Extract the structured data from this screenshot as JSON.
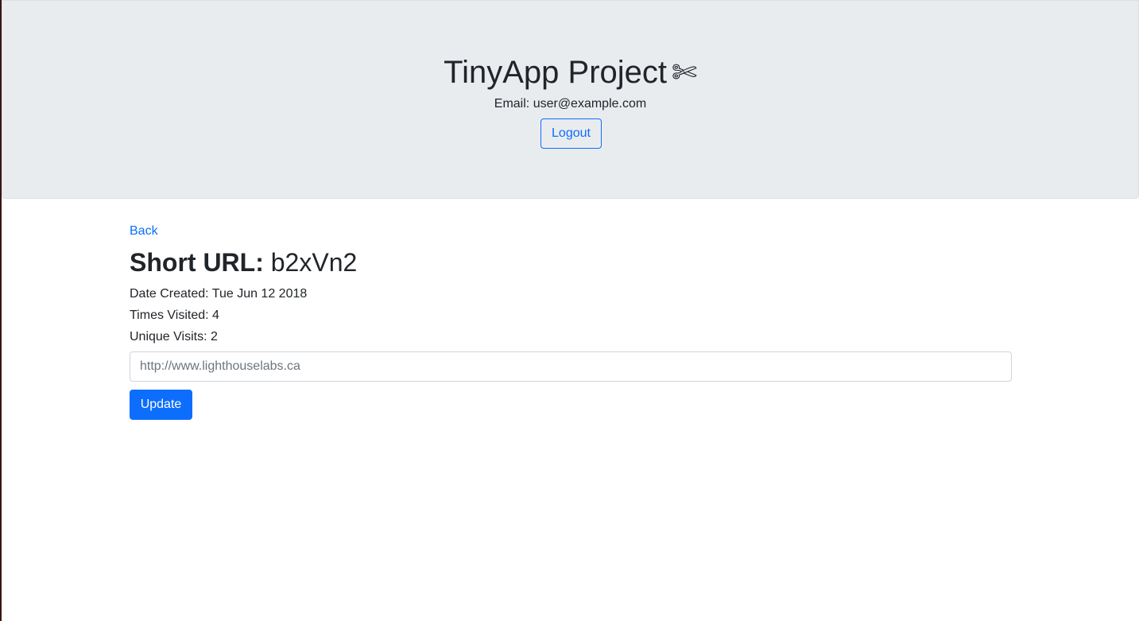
{
  "header": {
    "title": "TinyApp Project",
    "title_icon": "✄",
    "email_label": "Email:",
    "email_value": "user@example.com",
    "logout_label": "Logout"
  },
  "main": {
    "back_label": "Back",
    "heading_label": "Short URL:",
    "short_url": "b2xVn2",
    "date_created_label": "Date Created:",
    "date_created_value": "Tue Jun 12 2018",
    "times_visited_label": "Times Visited:",
    "times_visited_value": "4",
    "unique_visits_label": "Unique Visits:",
    "unique_visits_value": "2",
    "long_url_placeholder": "http://www.lighthouselabs.ca",
    "update_label": "Update"
  },
  "colors": {
    "primary": "#0d6efd",
    "jumbotron_bg": "#e9ecef",
    "text": "#212529"
  }
}
